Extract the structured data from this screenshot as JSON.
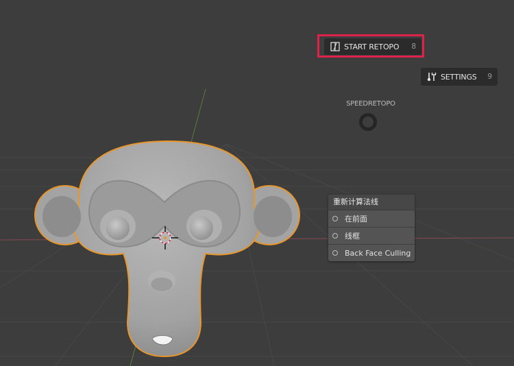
{
  "viewport": {
    "background": "#3d3d3d",
    "object_outline_color": "#e8962a"
  },
  "pie_menu": {
    "title": "SPEEDRETOPO",
    "start_retopo": {
      "label": "START RETOPO",
      "shortcut": "8",
      "icon": "retopo-icon"
    },
    "settings": {
      "label": "SETTINGS",
      "shortcut": "9",
      "icon": "tools-icon"
    },
    "highlight_color": "#e0224a"
  },
  "popup_menu": {
    "header": "重新计算法线",
    "items": [
      {
        "label": "在前面"
      },
      {
        "label": "线框"
      },
      {
        "label": "Back Face Culling"
      }
    ]
  }
}
